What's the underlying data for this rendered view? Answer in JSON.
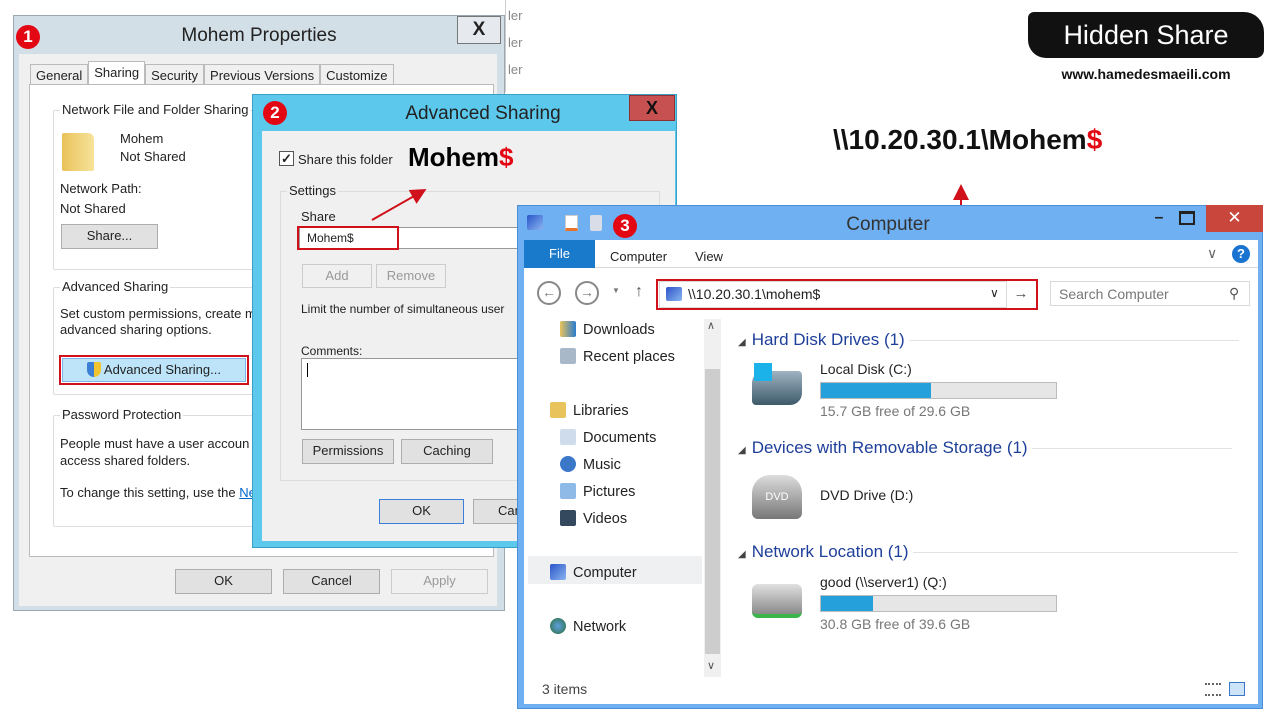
{
  "banner": {
    "title": "Hidden Share",
    "website": "www.hamedesmaeili.com"
  },
  "unc_caption": {
    "prefix": "\\\\10.20.30.1\\Mohem",
    "suffix": "$"
  },
  "bg_window": {
    "items": [
      "ler",
      "ler",
      "ler"
    ]
  },
  "properties": {
    "badge": "1",
    "title": "Mohem Properties",
    "close": "X",
    "tabs": [
      "General",
      "Sharing",
      "Security",
      "Previous Versions",
      "Customize"
    ],
    "active_tab": "Sharing",
    "nfs": {
      "legend": "Network File and Folder Sharing",
      "name": "Mohem",
      "status": "Not Shared",
      "path_label": "Network Path:",
      "path_value": "Not Shared",
      "share_button": "Share..."
    },
    "advanced": {
      "legend": "Advanced Sharing",
      "desc1": "Set custom permissions, create m",
      "desc2": "advanced sharing options.",
      "button": "Advanced Sharing..."
    },
    "password": {
      "legend": "Password Protection",
      "desc1": "People must have a user accoun",
      "desc2": "access shared folders.",
      "change": "To change this setting, use the ",
      "link": "Ne"
    },
    "buttons": {
      "ok": "OK",
      "cancel": "Cancel",
      "apply": "Apply"
    }
  },
  "advanced_sharing": {
    "badge": "2",
    "title": "Advanced Sharing",
    "close": "X",
    "share_checkbox": {
      "label": "Share this folder",
      "checked": true
    },
    "annotation": {
      "prefix": "Mohem",
      "suffix": "$"
    },
    "settings_legend": "Settings",
    "share_label": "Share",
    "share_value": "Mohem$",
    "add": "Add",
    "remove": "Remove",
    "limit_label": "Limit the number of simultaneous user",
    "comments_label": "Comments:",
    "comments_value": "",
    "permissions": "Permissions",
    "caching": "Caching",
    "ok": "OK",
    "cancel": "Can"
  },
  "explorer": {
    "badge": "3",
    "title": "Computer",
    "ribbon_tabs": [
      "File",
      "Computer",
      "View"
    ],
    "address": "\\\\10.20.30.1\\mohem$",
    "search_placeholder": "Search Computer",
    "nav": [
      "Downloads",
      "Recent places",
      "Libraries",
      "Documents",
      "Music",
      "Pictures",
      "Videos",
      "Computer",
      "Network"
    ],
    "sections": [
      {
        "title": "Hard Disk Drives (1)",
        "items": [
          {
            "name": "Local Disk (C:)",
            "free": "15.7 GB free of 29.6 GB",
            "used_fraction": 0.47
          }
        ]
      },
      {
        "title": "Devices with Removable Storage (1)",
        "items": [
          {
            "name": "DVD Drive (D:)"
          }
        ]
      },
      {
        "title": "Network Location (1)",
        "items": [
          {
            "name": "good (\\\\server1) (Q:)",
            "free": "30.8 GB free of 39.6 GB",
            "used_fraction": 0.22
          }
        ]
      }
    ],
    "status": "3 items",
    "colors": {
      "titlebar": "#6fb0f2",
      "file_tab": "#1979ca",
      "close": "#c9463d",
      "section": "#1e3f9a",
      "bar": "#26a0da"
    }
  },
  "colors": {
    "annotation_red": "#d0101a"
  }
}
